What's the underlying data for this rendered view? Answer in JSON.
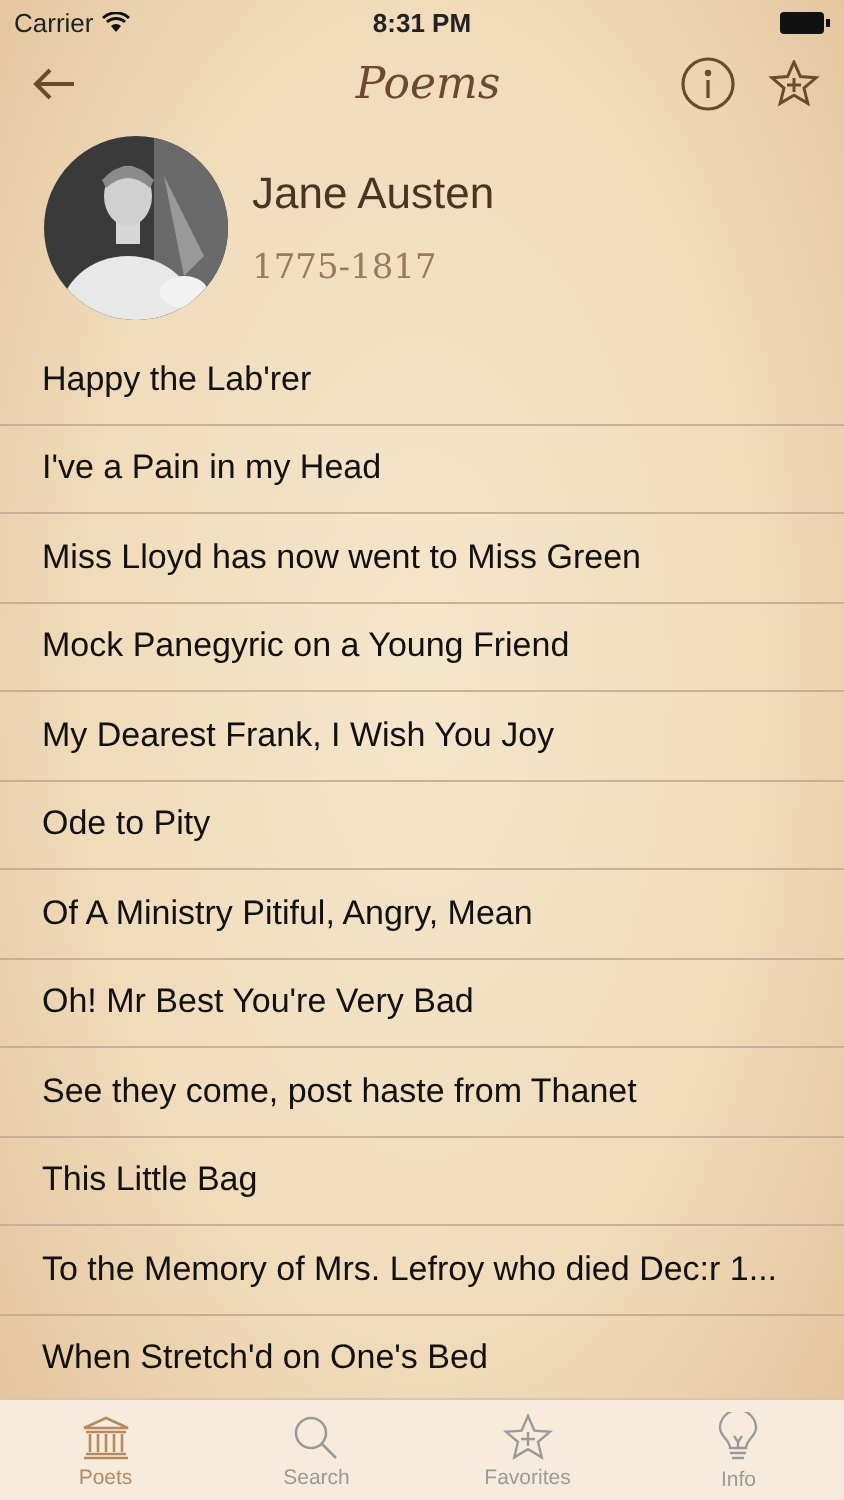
{
  "status_bar": {
    "carrier": "Carrier",
    "time": "8:31 PM"
  },
  "nav": {
    "title": "Poems"
  },
  "poet": {
    "name": "Jane Austen",
    "years": "1775-1817"
  },
  "poems": [
    {
      "title": "Happy the Lab'rer"
    },
    {
      "title": "I've a Pain in my Head"
    },
    {
      "title": "Miss Lloyd has now went to Miss Green"
    },
    {
      "title": "Mock Panegyric on a Young Friend"
    },
    {
      "title": "My Dearest Frank, I Wish You Joy"
    },
    {
      "title": "Ode to Pity"
    },
    {
      "title": "Of A Ministry Pitiful, Angry, Mean"
    },
    {
      "title": "Oh! Mr Best You're Very Bad"
    },
    {
      "title": "See they come, post haste from Thanet"
    },
    {
      "title": "This Little Bag"
    },
    {
      "title": "To the Memory of Mrs. Lefroy who died Dec:r 1..."
    },
    {
      "title": "When Stretch'd on One's Bed"
    }
  ],
  "tabs": [
    {
      "label": "Poets",
      "kind": "poets",
      "selected": true
    },
    {
      "label": "Search",
      "kind": "search",
      "selected": false
    },
    {
      "label": "Favorites",
      "kind": "favorites",
      "selected": false
    },
    {
      "label": "Info",
      "kind": "info",
      "selected": false
    }
  ]
}
